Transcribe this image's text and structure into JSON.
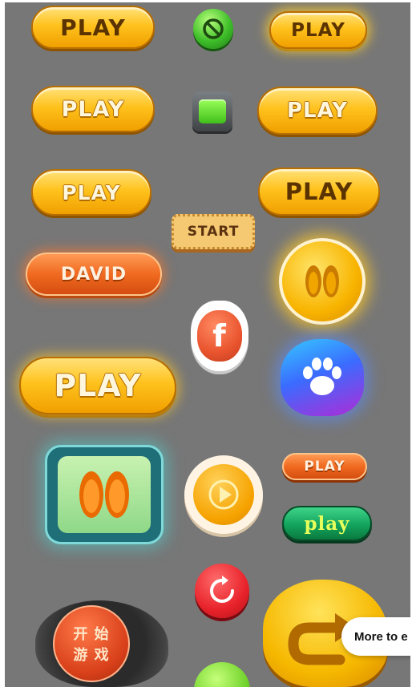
{
  "buttons": {
    "play_1": "PLAY",
    "play_2": "PLAY",
    "play_3": "PLAY",
    "play_4": "PLAY",
    "play_5": "PLAY",
    "play_6": "PLAY",
    "start": "START",
    "david": "DAVID",
    "play_big": "PLAY",
    "play_small": "PLAY",
    "play_green": "play",
    "facebook": "f",
    "chinese_top": "开 始",
    "chinese_bottom": "游 戏"
  },
  "overlay": {
    "more_to_explore": "More to e"
  },
  "icons": {
    "forbidden": "forbidden-icon",
    "green_square": "green-square-icon",
    "footprints": "footprints-icon",
    "paw": "paw-icon",
    "play_triangle": "play-triangle-icon",
    "restart": "restart-icon",
    "back_arrow": "back-arrow-icon"
  },
  "colors": {
    "background": "#777777",
    "yellow": "#ffc21d",
    "orange": "#f06a20",
    "green": "#13a35c",
    "teal": "#1f6f78",
    "red": "#e8222a",
    "blue": "#3a6cff",
    "purple": "#b02bd6"
  }
}
